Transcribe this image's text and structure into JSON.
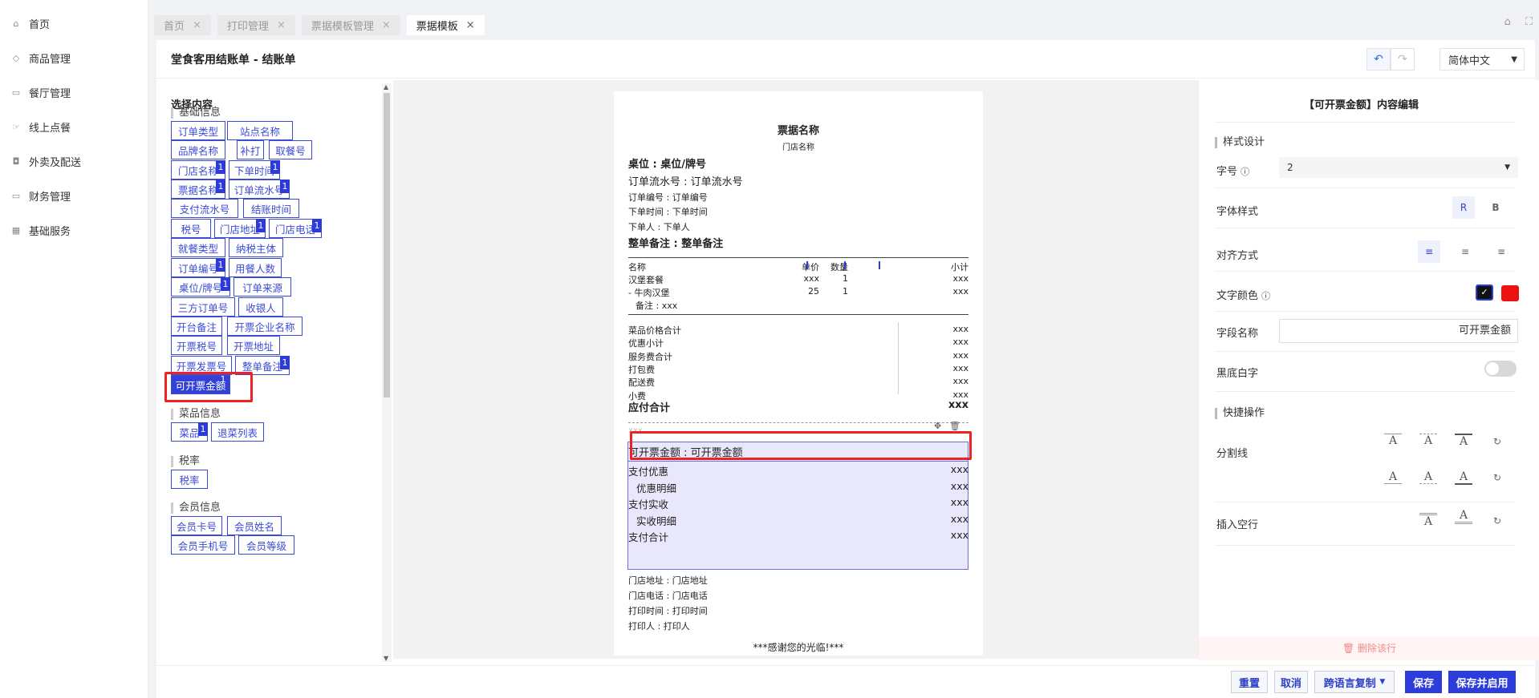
{
  "sidebar": {
    "items": [
      {
        "label": "首页",
        "icon": "home-icon",
        "glyph": "⌂"
      },
      {
        "label": "商品管理",
        "icon": "box-icon",
        "glyph": "◇"
      },
      {
        "label": "餐厅管理",
        "icon": "store-icon",
        "glyph": "▭"
      },
      {
        "label": "线上点餐",
        "icon": "hand-icon",
        "glyph": "☞"
      },
      {
        "label": "外卖及配送",
        "icon": "bag-icon",
        "glyph": "◘"
      },
      {
        "label": "财务管理",
        "icon": "wallet-icon",
        "glyph": "▭"
      },
      {
        "label": "基础服务",
        "icon": "grid-icon",
        "glyph": "▦"
      }
    ]
  },
  "tabs": [
    {
      "label": "首页",
      "active": false
    },
    {
      "label": "打印管理",
      "active": false
    },
    {
      "label": "票据模板管理",
      "active": false
    },
    {
      "label": "票据模板",
      "active": true
    }
  ],
  "header": {
    "title": "堂食客用结账单 - 结账单",
    "undo_icon": "undo-icon",
    "redo_icon": "redo-icon",
    "language": "简体中文"
  },
  "left_panel": {
    "title": "选择内容",
    "sections": [
      {
        "title": "基础信息"
      },
      {
        "title": "菜品信息"
      },
      {
        "title": "税率"
      },
      {
        "title": "会员信息"
      }
    ],
    "chips": [
      {
        "label": "订单类型",
        "count": ""
      },
      {
        "label": "站点名称",
        "count": ""
      },
      {
        "label": "品牌名称",
        "count": ""
      },
      {
        "label": "补打",
        "count": ""
      },
      {
        "label": "取餐号",
        "count": ""
      },
      {
        "label": "门店名称",
        "count": "1"
      },
      {
        "label": "下单时间",
        "count": "1"
      },
      {
        "label": "票据名称",
        "count": "1"
      },
      {
        "label": "订单流水号",
        "count": "1"
      },
      {
        "label": "支付流水号",
        "count": ""
      },
      {
        "label": "结账时间",
        "count": ""
      },
      {
        "label": "税号",
        "count": ""
      },
      {
        "label": "门店地址",
        "count": "1"
      },
      {
        "label": "门店电话",
        "count": "1"
      },
      {
        "label": "就餐类型",
        "count": ""
      },
      {
        "label": "纳税主体",
        "count": ""
      },
      {
        "label": "订单编号",
        "count": "1"
      },
      {
        "label": "用餐人数",
        "count": ""
      },
      {
        "label": "桌位/牌号",
        "count": "1"
      },
      {
        "label": "订单来源",
        "count": ""
      },
      {
        "label": "三方订单号",
        "count": ""
      },
      {
        "label": "收银人",
        "count": ""
      },
      {
        "label": "开台备注",
        "count": ""
      },
      {
        "label": "开票企业名称",
        "count": ""
      },
      {
        "label": "开票税号",
        "count": ""
      },
      {
        "label": "开票地址",
        "count": ""
      },
      {
        "label": "开票发票号",
        "count": ""
      },
      {
        "label": "整单备注",
        "count": "1"
      },
      {
        "label": "可开票金额",
        "count": "1"
      },
      {
        "label": "菜品",
        "count": "1"
      },
      {
        "label": "退菜列表",
        "count": ""
      },
      {
        "label": "税率",
        "count": ""
      },
      {
        "label": "会员卡号",
        "count": ""
      },
      {
        "label": "会员姓名",
        "count": ""
      },
      {
        "label": "会员手机号",
        "count": ""
      },
      {
        "label": "会员等级",
        "count": ""
      }
    ]
  },
  "receipt": {
    "title": "票据名称",
    "store_name": "门店名称",
    "table": "桌位 : 桌位/牌号",
    "serial": "订单流水号 : 订单流水号",
    "order_no": "订单编号 : 订单编号",
    "order_time": "下单时间 : 下单时间",
    "orderer": "下单人 : 下单人",
    "remark": "整单备注 : 整单备注",
    "item_headers": [
      "名称",
      "单价",
      "数量",
      "小计"
    ],
    "items": [
      {
        "name": "汉堡套餐",
        "price": "xxx",
        "qty": "1",
        "subtotal": "xxx"
      },
      {
        "name": "- 牛肉汉堡",
        "price": "25",
        "qty": "1",
        "subtotal": "xxx"
      }
    ],
    "item_note": "备注 : xxx",
    "summary": [
      {
        "label": "菜品价格合计",
        "value": "xxx"
      },
      {
        "label": "优惠小计",
        "value": "xxx"
      },
      {
        "label": "服务费合计",
        "value": "xxx"
      },
      {
        "label": "打包费",
        "value": "xxx"
      },
      {
        "label": "配送费",
        "value": "xxx"
      },
      {
        "label": "小费",
        "value": "xxx"
      }
    ],
    "total_label": "应付合计",
    "total_value": "xxx",
    "faded_value": "xxx",
    "move_icon": "move-icon",
    "delete_icon": "trash-icon",
    "invoice_line": "可开票金额 : 可开票金额",
    "payments": [
      {
        "label": "支付优惠",
        "value": "xxx",
        "indent": false
      },
      {
        "label": "优惠明细",
        "value": "xxx",
        "indent": true
      },
      {
        "label": "支付实收",
        "value": "xxx",
        "indent": false
      },
      {
        "label": "实收明细",
        "value": "xxx",
        "indent": true
      },
      {
        "label": "支付合计",
        "value": "xxx",
        "indent": false
      }
    ],
    "address": "门店地址 : 门店地址",
    "phone": "门店电话 : 门店电话",
    "print_time": "打印时间 : 打印时间",
    "printer": "打印人 : 打印人",
    "thanks": "***感谢您的光临!***"
  },
  "right_panel": {
    "title": "【可开票金额】内容编辑",
    "style_section": "样式设计",
    "font_size_label": "字号",
    "font_size_value": "2",
    "font_style_label": "字体样式",
    "font_style_r": "R",
    "font_style_b": "B",
    "align_label": "对齐方式",
    "text_color_label": "文字颜色",
    "colors": [
      "#111111",
      "#ee1111"
    ],
    "field_name_label": "字段名称",
    "field_name_value": "可开票金额",
    "invert_label": "黑底白字",
    "quick_section": "快捷操作",
    "divider_label": "分割线",
    "blank_label": "插入空行",
    "glyph_a": "A",
    "delete_row": "删除该行"
  },
  "footer": {
    "reset": "重置",
    "cancel": "取消",
    "copy_lang": "跨语言复制",
    "save": "保存",
    "save_enable": "保存并启用"
  }
}
